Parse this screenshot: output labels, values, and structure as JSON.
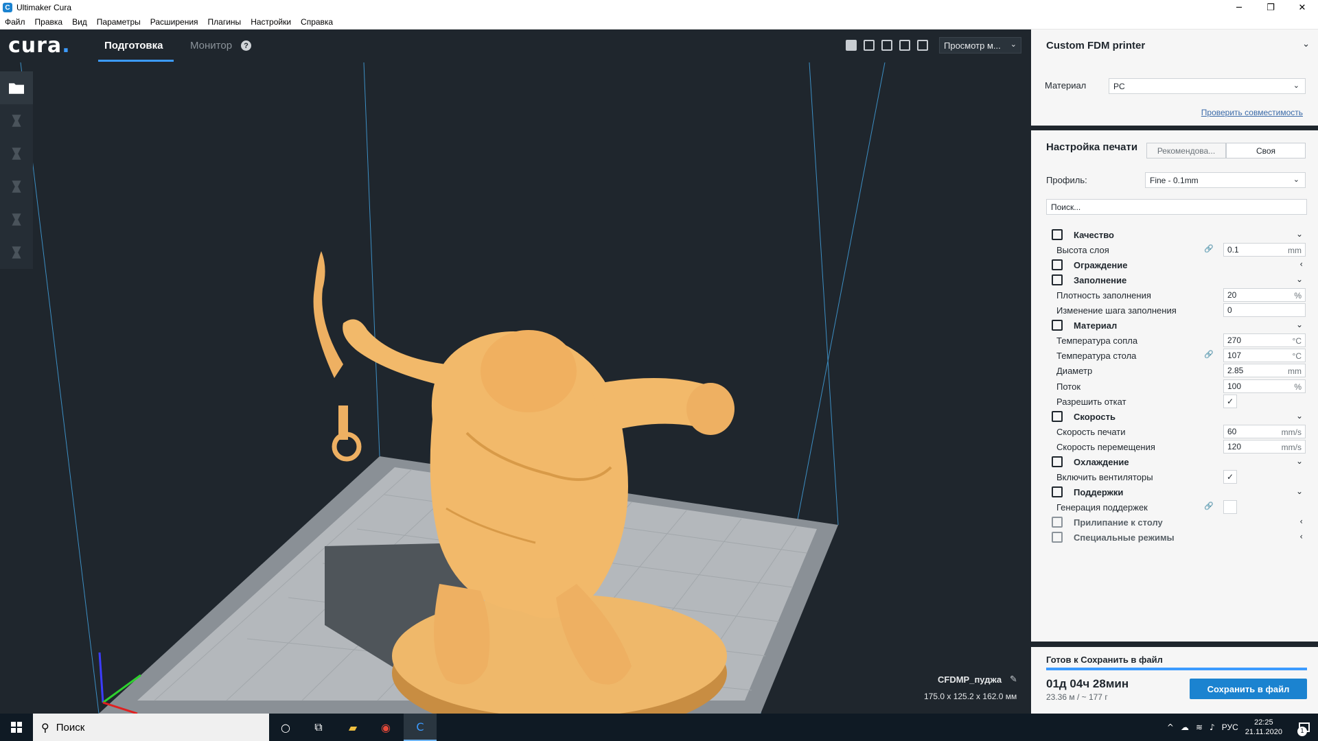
{
  "window": {
    "title": "Ultimaker Cura",
    "icon": "cura-app-icon"
  },
  "menu": [
    "Файл",
    "Правка",
    "Вид",
    "Параметры",
    "Расширения",
    "Плагины",
    "Настройки",
    "Справка"
  ],
  "header": {
    "logo": "cura",
    "tabs": [
      {
        "label": "Подготовка",
        "active": true
      },
      {
        "label": "Монитор",
        "active": false
      }
    ],
    "view_mode": "Просмотр м..."
  },
  "model": {
    "name": "CFDMP_пуджа",
    "dimensions": "175.0 x 125.2 x 162.0 мм",
    "color": "#f0b868"
  },
  "printer": {
    "name": "Custom FDM printer",
    "material_label": "Материал",
    "material_value": "PC",
    "compat_link": "Проверить совместимость"
  },
  "print_settings": {
    "title": "Настройка печати",
    "mode_recommended": "Рекомендова...",
    "mode_custom": "Своя",
    "profile_label": "Профиль:",
    "profile_value": "Fine - 0.1mm",
    "search_placeholder": "Поиск...",
    "rows": [
      {
        "type": "cat",
        "label": "Качество",
        "icon": "quality-icon",
        "expanded": true
      },
      {
        "type": "set",
        "label": "Высота слоя",
        "value": "0.1",
        "unit": "mm",
        "linked": true
      },
      {
        "type": "cat",
        "label": "Ограждение",
        "icon": "shell-icon",
        "expanded": false
      },
      {
        "type": "cat",
        "label": "Заполнение",
        "icon": "infill-icon",
        "expanded": true
      },
      {
        "type": "set",
        "label": "Плотность заполнения",
        "value": "20",
        "unit": "%"
      },
      {
        "type": "set",
        "label": "Изменение шага заполнения",
        "value": "0",
        "unit": ""
      },
      {
        "type": "cat",
        "label": "Материал",
        "icon": "material-icon",
        "expanded": true
      },
      {
        "type": "set",
        "label": "Температура сопла",
        "value": "270",
        "unit": "°C"
      },
      {
        "type": "set",
        "label": "Температура стола",
        "value": "107",
        "unit": "°C",
        "linked": true
      },
      {
        "type": "set",
        "label": "Диаметр",
        "value": "2.85",
        "unit": "mm"
      },
      {
        "type": "set",
        "label": "Поток",
        "value": "100",
        "unit": "%"
      },
      {
        "type": "check",
        "label": "Разрешить откат",
        "checked": true
      },
      {
        "type": "cat",
        "label": "Скорость",
        "icon": "speed-icon",
        "expanded": true
      },
      {
        "type": "set",
        "label": "Скорость печати",
        "value": "60",
        "unit": "mm/s"
      },
      {
        "type": "set",
        "label": "Скорость перемещения",
        "value": "120",
        "unit": "mm/s"
      },
      {
        "type": "cat",
        "label": "Охлаждение",
        "icon": "cooling-icon",
        "expanded": true
      },
      {
        "type": "check",
        "label": "Включить вентиляторы",
        "checked": true
      },
      {
        "type": "cat",
        "label": "Поддержки",
        "icon": "support-icon",
        "expanded": true
      },
      {
        "type": "check",
        "label": "Генерация поддержек",
        "checked": false,
        "linked": true
      },
      {
        "type": "cat",
        "label": "Прилипание к столу",
        "icon": "adhesion-icon",
        "expanded": false,
        "faded": true
      },
      {
        "type": "cat",
        "label": "Специальные режимы",
        "icon": "special-modes-icon",
        "expanded": false,
        "faded": true
      }
    ]
  },
  "save": {
    "status": "Готов к Сохранить в файл",
    "progress": 1.0,
    "time": "01д 04ч 28мин",
    "material": "23.36 м / ~ 177 г",
    "button": "Сохранить в файл"
  },
  "taskbar": {
    "search": "Поиск",
    "lang": "РУС",
    "time": "22:25",
    "date": "21.11.2020",
    "notifications": "1"
  }
}
